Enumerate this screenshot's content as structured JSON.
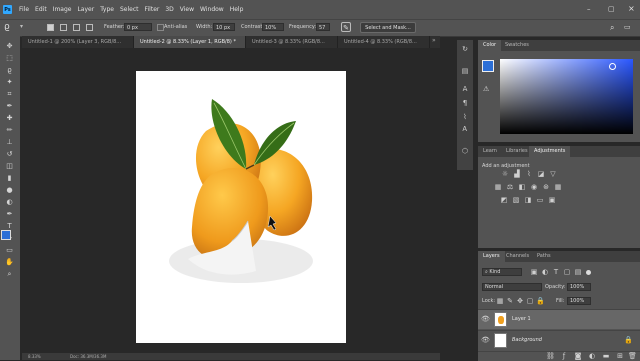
{
  "menu": {
    "app_icon": "Ps",
    "items": [
      "File",
      "Edit",
      "Image",
      "Layer",
      "Type",
      "Select",
      "Filter",
      "3D",
      "View",
      "Window",
      "Help"
    ]
  },
  "options": {
    "feather_label": "Feather:",
    "feather_value": "0 px",
    "anti_alias_label": "Anti-alias",
    "width_label": "Width:",
    "width_value": "10 px",
    "contrast_label": "Contrast:",
    "contrast_value": "10%",
    "frequency_label": "Frequency:",
    "frequency_value": "57",
    "select_mask_label": "Select and Mask..."
  },
  "tabs": [
    {
      "label": "Untitled-1 @ 200% (Layer 3, RGB/8..."
    },
    {
      "label": "Untitled-2 @ 8.33% (Layer 1, RGB/8) *"
    },
    {
      "label": "Untitled-3 @ 8.33% (RGB/8..."
    },
    {
      "label": "Untitled-4 @ 8.33% (RGB/8..."
    }
  ],
  "status": {
    "zoom": "8.33%",
    "doc": "Doc: 36.3M/36.3M"
  },
  "color_panel": {
    "tabs": [
      "Color",
      "Swatches"
    ],
    "foreground": "#2c6fd6",
    "hue": "#2a57ff"
  },
  "learn_panel": {
    "tabs": [
      "Learn",
      "Libraries",
      "Adjustments"
    ],
    "add_adjustment": "Add an adjustment"
  },
  "layers_panel": {
    "tabs": [
      "Layers",
      "Channels",
      "Paths"
    ],
    "kind": "Kind",
    "blend_mode": "Normal",
    "opacity_label": "Opacity:",
    "opacity_value": "100%",
    "lock_label": "Lock:",
    "fill_label": "Fill:",
    "fill_value": "100%",
    "layers": [
      {
        "name": "Layer 1"
      },
      {
        "name": "Background"
      }
    ]
  }
}
